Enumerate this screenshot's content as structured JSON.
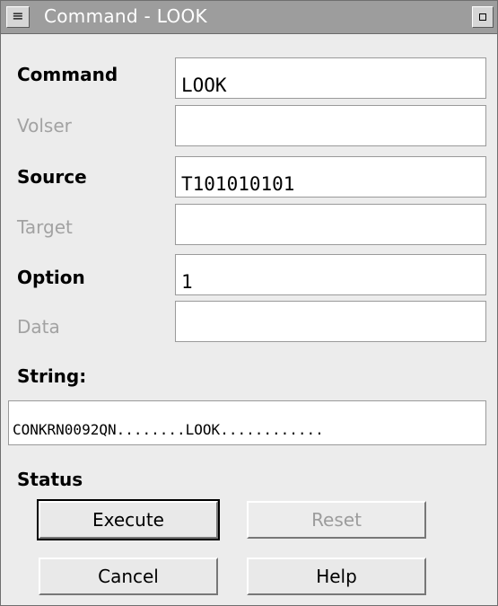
{
  "window": {
    "title": "Command - LOOK",
    "sysmenu_glyph": "≡"
  },
  "fields": [
    {
      "label": "Command",
      "value": "LOOK",
      "enabled": true
    },
    {
      "label": "Volser",
      "value": "",
      "enabled": false
    },
    {
      "label": "Source",
      "value": "T101010101",
      "enabled": true
    },
    {
      "label": "Target",
      "value": "",
      "enabled": false
    },
    {
      "label": "Option",
      "value": "1",
      "enabled": true
    },
    {
      "label": "Data",
      "value": "",
      "enabled": false
    }
  ],
  "string": {
    "label": "String:",
    "value": "CONKRN0092QN........LOOK............"
  },
  "status": {
    "label": "Status"
  },
  "buttons": {
    "execute": "Execute",
    "reset": "Reset",
    "cancel": "Cancel",
    "help": "Help"
  },
  "colors": {
    "titlebar": "#9d9d9d",
    "window_bg": "#ececec",
    "disabled_text": "#a2a2a2"
  }
}
